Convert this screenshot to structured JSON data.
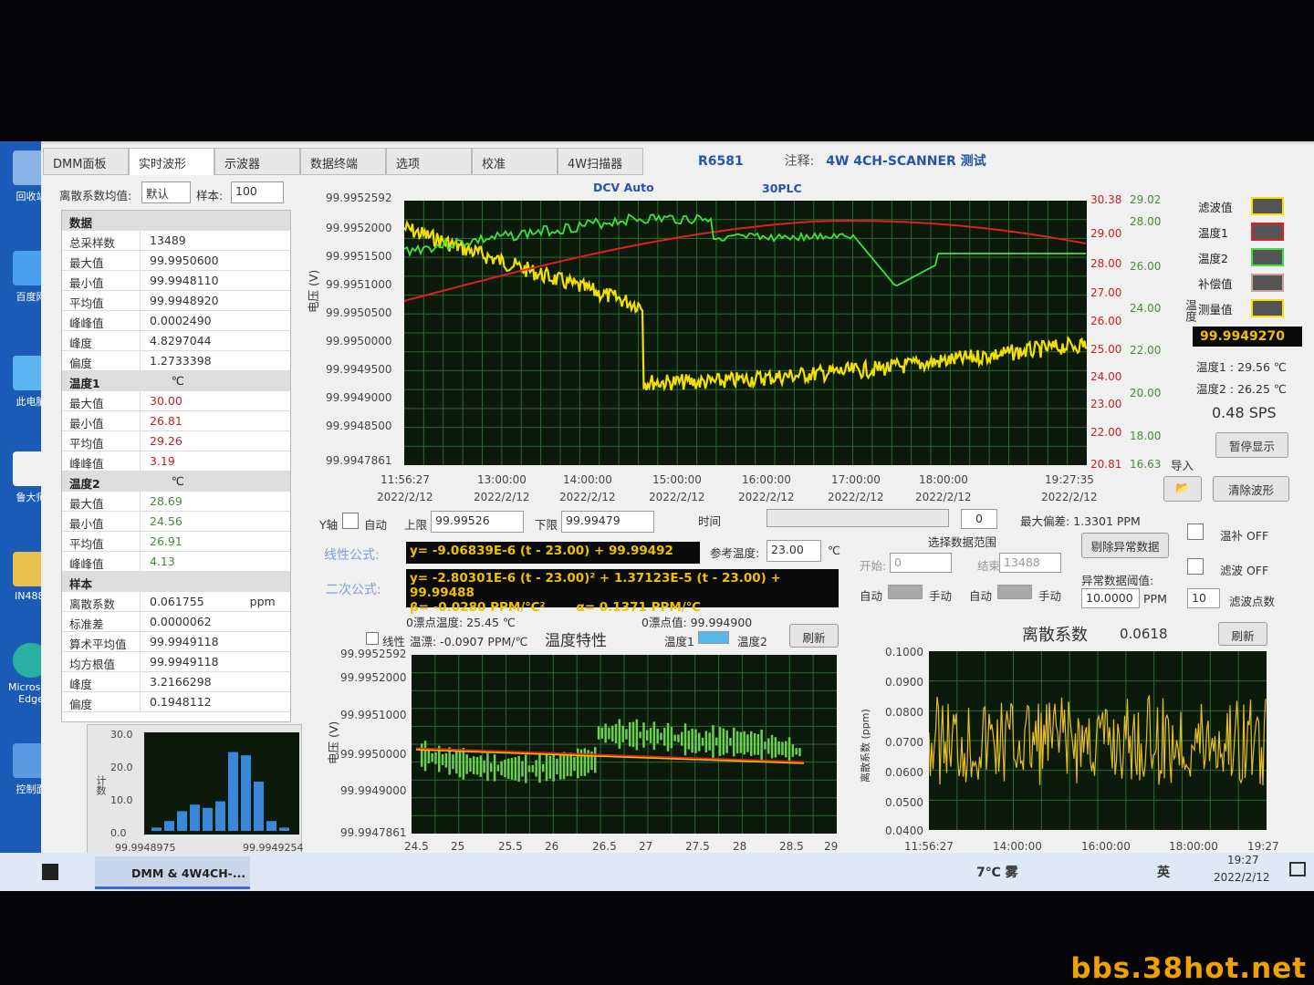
{
  "desktop": {
    "icons": [
      "回收站",
      "百度网",
      "此电脑",
      "鲁大师",
      "IN488.",
      "Microsoft Edge",
      "控制面"
    ]
  },
  "tabs": [
    "DMM面板",
    "实时波形",
    "示波器",
    "数据终端",
    "选项",
    "校准",
    "4W扫描器"
  ],
  "header": {
    "model": "R6581",
    "note_label": "注释:",
    "note": "4W 4CH-SCANNER 测试",
    "mode": "DCV Auto",
    "plc": "30PLC"
  },
  "controls": {
    "coef_label": "离散系数均值:",
    "coef_value": "默认",
    "samples_label": "样本:",
    "samples_value": "100"
  },
  "stats": {
    "data_title": "数据",
    "data": [
      [
        "总采样数",
        "13489"
      ],
      [
        "最大值",
        "99.9950600"
      ],
      [
        "最小值",
        "99.9948110"
      ],
      [
        "平均值",
        "99.9948920"
      ],
      [
        "峰峰值",
        "0.0002490"
      ],
      [
        "峰度",
        "4.8297044"
      ],
      [
        "偏度",
        "1.2733398"
      ]
    ],
    "t1_title": "温度1",
    "t1_unit": "℃",
    "t1": [
      [
        "最大值",
        "30.00"
      ],
      [
        "最小值",
        "26.81"
      ],
      [
        "平均值",
        "29.26"
      ],
      [
        "峰峰值",
        "3.19"
      ]
    ],
    "t2_title": "温度2",
    "t2_unit": "℃",
    "t2": [
      [
        "最大值",
        "28.69"
      ],
      [
        "最小值",
        "24.56"
      ],
      [
        "平均值",
        "26.91"
      ],
      [
        "峰峰值",
        "4.13"
      ]
    ],
    "s_title": "样本",
    "s": [
      [
        "离散系数",
        "0.061755",
        "ppm"
      ],
      [
        "标准差",
        "0.0000062",
        ""
      ],
      [
        "算术平均值",
        "99.9949118",
        ""
      ],
      [
        "均方根值",
        "99.9949118",
        ""
      ],
      [
        "峰度",
        "3.2166298",
        ""
      ],
      [
        "偏度",
        "0.1948112",
        ""
      ]
    ]
  },
  "hist": {
    "ylabel": "计数",
    "yticks": [
      "30.0",
      "20.0",
      "10.0",
      "0.0"
    ],
    "xmin": "99.9948975",
    "xmax": "99.9949254"
  },
  "main_chart": {
    "yticks": [
      "99.9952592",
      "99.9952000",
      "99.9951500",
      "99.9951000",
      "99.9950500",
      "99.9950000",
      "99.9949500",
      "99.9949000",
      "99.9948500",
      "99.9947861"
    ],
    "ylabel": "电压 (V)",
    "xticks": [
      [
        "11:56:27",
        "2022/2/12"
      ],
      [
        "13:00:00",
        "2022/2/12"
      ],
      [
        "14:00:00",
        "2022/2/12"
      ],
      [
        "15:00:00",
        "2022/2/12"
      ],
      [
        "16:00:00",
        "2022/2/12"
      ],
      [
        "17:00:00",
        "2022/2/12"
      ],
      [
        "18:00:00",
        "2022/2/12"
      ],
      [
        "19:27:35",
        "2022/2/12"
      ]
    ],
    "r1ticks": [
      "30.38",
      "29.00",
      "28.00",
      "27.00",
      "26.00",
      "25.00",
      "24.00",
      "23.00",
      "22.00",
      "20.81"
    ],
    "r2ticks": [
      "29.02",
      "28.00",
      "26.00",
      "24.00",
      "22.00",
      "20.00",
      "18.00",
      "16.63"
    ],
    "rlabel": "温度"
  },
  "legend": {
    "items": [
      "滤波值",
      "温度1",
      "温度2",
      "补偿值",
      "测量值"
    ],
    "reading": "99.9949270",
    "t1": "温度1 : 29.56 ℃",
    "t2": "温度2 : 26.25 ℃",
    "sps": "0.48 SPS",
    "pause": "暂停显示",
    "import": "导入",
    "clear": "清除波形"
  },
  "yaxis": {
    "label": "Y轴",
    "auto": "自动",
    "upper_label": "上限",
    "upper": "99.99526",
    "lower_label": "下限",
    "lower": "99.99479",
    "time": "时间",
    "time_value": "0",
    "max_dev": "最大偏差: 1.3301 PPM"
  },
  "formula": {
    "linear_label": "线性公式:",
    "linear": "y= -9.06839E-6 (t - 23.00) + 99.99492",
    "ref_label": "参考温度:",
    "ref": "23.00",
    "ref_unit": "℃",
    "quad_label": "二次公式:",
    "quad": "y= -2.80301E-6 (t - 23.00)² + 1.37123E-5 (t - 23.00) + 99.99488",
    "beta": "β= -0.0280 PPM/℃²",
    "alpha": "α= 0.1371 PPM/℃",
    "zero_temp": "0漂点温度: 25.45 ℃",
    "zero_val": "0漂点值: 99.994900"
  },
  "range": {
    "title": "选择数据范围",
    "start_label": "开始:",
    "start": "0",
    "end_label": "结束:",
    "end": "13488",
    "auto": "自动",
    "manual": "手动",
    "remove": "剔除异常数据",
    "thr_label": "异常数据阈值:",
    "thr": "10.0000",
    "thr_unit": "PPM",
    "filt": "10",
    "filt_label": "滤波点数",
    "comp": "温补 OFF",
    "filter": "滤波 OFF"
  },
  "temp_chart": {
    "linear": "线性",
    "drift": "温漂: -0.0907 PPM/℃",
    "title": "温度特性",
    "t1": "温度1",
    "t2": "温度2",
    "refresh": "刷新",
    "yticks": [
      "99.9952592",
      "99.9952000",
      "99.9951000",
      "99.9950000",
      "99.9949000",
      "99.9947861"
    ],
    "xticks": [
      "24.5",
      "25",
      "25.5",
      "26",
      "26.5",
      "27",
      "27.5",
      "28",
      "28.5",
      "29"
    ],
    "ylabel": "电压 (V)"
  },
  "disp_chart": {
    "title": "离散系数",
    "value": "0.0618",
    "refresh": "刷新",
    "yticks": [
      "0.1000",
      "0.0900",
      "0.0800",
      "0.0700",
      "0.0600",
      "0.0500",
      "0.0400"
    ],
    "xticks": [
      "11:56:27",
      "14:00:00",
      "16:00:00",
      "18:00:00",
      "19:27"
    ],
    "ylabel": "离散系数 (ppm)"
  },
  "taskbar": {
    "app": "DMM & 4W4CH-...",
    "weather": "7℃ 雾",
    "ime": "英",
    "time": "19:27",
    "date": "2022/2/12"
  },
  "watermark": "bbs.38hot.net",
  "colors": {
    "grid": "#2e6a2e",
    "yellow": "#f2e000",
    "red": "#e02020",
    "green": "#40e040"
  }
}
